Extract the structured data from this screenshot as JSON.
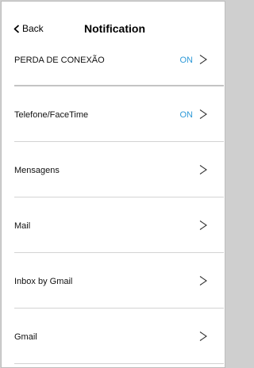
{
  "header": {
    "back_label": "Back",
    "title": "Notification"
  },
  "rows": [
    {
      "label": "PERDA DE CONEXÃO",
      "status": "ON"
    },
    {
      "label": "Telefone/FaceTime",
      "status": "ON"
    },
    {
      "label": "Mensagens",
      "status": ""
    },
    {
      "label": "Mail",
      "status": ""
    },
    {
      "label": "Inbox by Gmail",
      "status": ""
    },
    {
      "label": "Gmail",
      "status": ""
    }
  ],
  "colors": {
    "accent": "#2f9ad8",
    "divider": "#d3d3d3",
    "background": "#ffffff"
  },
  "icons": {
    "back": "chevron-left-icon",
    "row_disclosure": "chevron-right-icon"
  }
}
